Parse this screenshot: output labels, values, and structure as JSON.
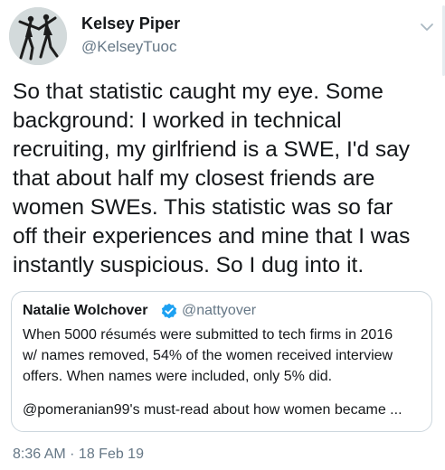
{
  "author": {
    "display_name": "Kelsey Piper",
    "handle": "@KelseyTuoc",
    "avatar_icon": "dancing-couple-avatar"
  },
  "menu_icon": "chevron-down-icon",
  "tweet": {
    "lines": [
      "So that statistic caught my eye. Some",
      "background: I worked in technical",
      "recruiting, my girlfriend is a SWE, I'd say",
      "that about half my closest friends are",
      "women SWEs. This statistic was so far",
      "off their experiences and mine that I was",
      "instantly suspicious. So I dug into it."
    ]
  },
  "quote": {
    "display_name": "Natalie Wolchover",
    "verified_icon": "verified-badge-icon",
    "handle": "@nattyover",
    "lines": [
      "When 5000 résumés were submitted to tech firms in 2016",
      "w/ names removed, 54% of the women received interview",
      "offers. When names were included, only 5% did."
    ],
    "more_line": "@pomeranian99's must-read about how women became ..."
  },
  "timestamp": {
    "time": "8:36 AM",
    "separator": " · ",
    "date": "18 Feb 19"
  },
  "colors": {
    "text": "#14171a",
    "secondary": "#657786",
    "border": "#ccd6dd",
    "verified": "#1da1f2"
  }
}
